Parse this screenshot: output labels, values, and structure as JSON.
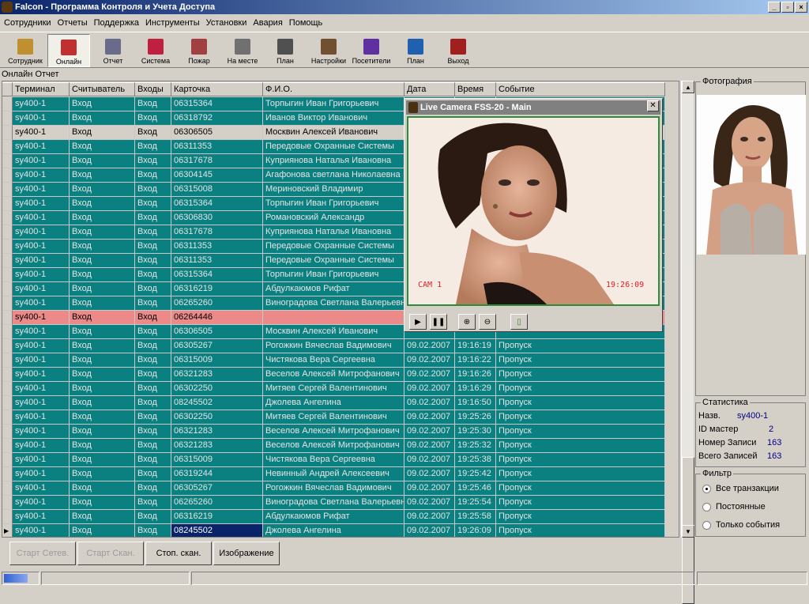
{
  "window": {
    "title": "Falcon - Программа Контроля и Учета Доступа"
  },
  "menu": [
    "Сотрудники",
    "Отчеты",
    "Поддержка",
    "Инструменты",
    "Установки",
    "Авария",
    "Помощь"
  ],
  "toolbar": [
    {
      "label": "Сотрудник",
      "icon": "employee-icon",
      "color": "#c09030"
    },
    {
      "label": "Онлайн",
      "icon": "online-icon",
      "color": "#c03030"
    },
    {
      "label": "Отчет",
      "icon": "report-icon",
      "color": "#6a6a8a"
    },
    {
      "label": "Система",
      "icon": "system-icon",
      "color": "#c02040"
    },
    {
      "label": "Пожар",
      "icon": "fire-icon",
      "color": "#a04040"
    },
    {
      "label": "На месте",
      "icon": "onsite-icon",
      "color": "#707070"
    },
    {
      "label": "План",
      "icon": "plan-icon",
      "color": "#505050"
    },
    {
      "label": "Настройки",
      "icon": "settings-icon",
      "color": "#705030"
    },
    {
      "label": "Посетители",
      "icon": "visitors-icon",
      "color": "#6030a0"
    },
    {
      "label": "План",
      "icon": "globe-icon",
      "color": "#2060b0"
    },
    {
      "label": "Выход",
      "icon": "exit-icon",
      "color": "#a02020"
    }
  ],
  "online_report_label": "Онлайн Отчет",
  "columns": [
    "Терминал",
    "Считыватель",
    "Входы",
    "Карточка",
    "Ф.И.О.",
    "Дата",
    "Время",
    "Событие"
  ],
  "rows": [
    {
      "style": "teal",
      "term": "sy400-1",
      "reader": "Вход",
      "input": "Вход",
      "card": "06315364",
      "name": "Торпыгин Иван Григорьевич",
      "date": "",
      "time": "",
      "event": ""
    },
    {
      "style": "teal",
      "term": "sy400-1",
      "reader": "Вход",
      "input": "Вход",
      "card": "06318792",
      "name": "Иванов Виктор Иванович",
      "date": "",
      "time": "",
      "event": ""
    },
    {
      "style": "gray",
      "term": "sy400-1",
      "reader": "Вход",
      "input": "Вход",
      "card": "06306505",
      "name": "Москвин Алексей Иванович",
      "date": "",
      "time": "",
      "event": ""
    },
    {
      "style": "teal",
      "term": "sy400-1",
      "reader": "Вход",
      "input": "Вход",
      "card": "06311353",
      "name": "Передовые Охранные Системы",
      "date": "",
      "time": "",
      "event": ""
    },
    {
      "style": "teal",
      "term": "sy400-1",
      "reader": "Вход",
      "input": "Вход",
      "card": "06317678",
      "name": "Куприянова Наталья Ивановна",
      "date": "",
      "time": "",
      "event": ""
    },
    {
      "style": "teal",
      "term": "sy400-1",
      "reader": "Вход",
      "input": "Вход",
      "card": "06304145",
      "name": "Агафонова светлана Николаевна",
      "date": "",
      "time": "",
      "event": ""
    },
    {
      "style": "teal",
      "term": "sy400-1",
      "reader": "Вход",
      "input": "Вход",
      "card": "06315008",
      "name": "Мериновский Владимир",
      "date": "",
      "time": "",
      "event": ""
    },
    {
      "style": "teal",
      "term": "sy400-1",
      "reader": "Вход",
      "input": "Вход",
      "card": "06315364",
      "name": "Торпыгин Иван Григорьевич",
      "date": "",
      "time": "",
      "event": ""
    },
    {
      "style": "teal",
      "term": "sy400-1",
      "reader": "Вход",
      "input": "Вход",
      "card": "06306830",
      "name": "Романовский Александр",
      "date": "",
      "time": "",
      "event": ""
    },
    {
      "style": "teal",
      "term": "sy400-1",
      "reader": "Вход",
      "input": "Вход",
      "card": "06317678",
      "name": "Куприянова Наталья Ивановна",
      "date": "",
      "time": "",
      "event": ""
    },
    {
      "style": "teal",
      "term": "sy400-1",
      "reader": "Вход",
      "input": "Вход",
      "card": "06311353",
      "name": "Передовые Охранные Системы",
      "date": "",
      "time": "",
      "event": ""
    },
    {
      "style": "teal",
      "term": "sy400-1",
      "reader": "Вход",
      "input": "Вход",
      "card": "06311353",
      "name": "Передовые Охранные Системы",
      "date": "",
      "time": "",
      "event": ""
    },
    {
      "style": "teal",
      "term": "sy400-1",
      "reader": "Вход",
      "input": "Вход",
      "card": "06315364",
      "name": "Торпыгин Иван Григорьевич",
      "date": "",
      "time": "",
      "event": ""
    },
    {
      "style": "teal",
      "term": "sy400-1",
      "reader": "Вход",
      "input": "Вход",
      "card": "06316219",
      "name": "Абдулкаюмов Рифат",
      "date": "",
      "time": "",
      "event": ""
    },
    {
      "style": "teal",
      "term": "sy400-1",
      "reader": "Вход",
      "input": "Вход",
      "card": "06265260",
      "name": "Виноградова Светлана Валерьевна",
      "date": "",
      "time": "",
      "event": ""
    },
    {
      "style": "pink",
      "term": "sy400-1",
      "reader": "Вход",
      "input": "Вход",
      "card": "06264446",
      "name": "",
      "date": "",
      "time": "",
      "event": ""
    },
    {
      "style": "teal",
      "term": "sy400-1",
      "reader": "Вход",
      "input": "Вход",
      "card": "06306505",
      "name": "Москвин Алексей Иванович",
      "date": "",
      "time": "",
      "event": ""
    },
    {
      "style": "teal",
      "term": "sy400-1",
      "reader": "Вход",
      "input": "Вход",
      "card": "06305267",
      "name": "Рогожкин Вячеслав Вадимович",
      "date": "09.02.2007",
      "time": "19:16:19",
      "event": "Пропуск"
    },
    {
      "style": "teal",
      "term": "sy400-1",
      "reader": "Вход",
      "input": "Вход",
      "card": "06315009",
      "name": "Чистякова Вера Сергеевна",
      "date": "09.02.2007",
      "time": "19:16:22",
      "event": "Пропуск"
    },
    {
      "style": "teal",
      "term": "sy400-1",
      "reader": "Вход",
      "input": "Вход",
      "card": "06321283",
      "name": "Веселов Алексей Митрофанович",
      "date": "09.02.2007",
      "time": "19:16:26",
      "event": "Пропуск"
    },
    {
      "style": "teal",
      "term": "sy400-1",
      "reader": "Вход",
      "input": "Вход",
      "card": "06302250",
      "name": "Митяев Сергей Валентинович",
      "date": "09.02.2007",
      "time": "19:16:29",
      "event": "Пропуск"
    },
    {
      "style": "teal",
      "term": "sy400-1",
      "reader": "Вход",
      "input": "Вход",
      "card": "08245502",
      "name": "Джолева Ангелина",
      "date": "09.02.2007",
      "time": "19:16:50",
      "event": "Пропуск"
    },
    {
      "style": "teal",
      "term": "sy400-1",
      "reader": "Вход",
      "input": "Вход",
      "card": "06302250",
      "name": "Митяев Сергей Валентинович",
      "date": "09.02.2007",
      "time": "19:25:26",
      "event": "Пропуск"
    },
    {
      "style": "teal",
      "term": "sy400-1",
      "reader": "Вход",
      "input": "Вход",
      "card": "06321283",
      "name": "Веселов Алексей Митрофанович",
      "date": "09.02.2007",
      "time": "19:25:30",
      "event": "Пропуск"
    },
    {
      "style": "teal",
      "term": "sy400-1",
      "reader": "Вход",
      "input": "Вход",
      "card": "06321283",
      "name": "Веселов Алексей Митрофанович",
      "date": "09.02.2007",
      "time": "19:25:32",
      "event": "Пропуск"
    },
    {
      "style": "teal",
      "term": "sy400-1",
      "reader": "Вход",
      "input": "Вход",
      "card": "06315009",
      "name": "Чистякова Вера Сергеевна",
      "date": "09.02.2007",
      "time": "19:25:38",
      "event": "Пропуск"
    },
    {
      "style": "teal",
      "term": "sy400-1",
      "reader": "Вход",
      "input": "Вход",
      "card": "06319244",
      "name": "Невинный Андрей Алексеевич",
      "date": "09.02.2007",
      "time": "19:25:42",
      "event": "Пропуск"
    },
    {
      "style": "teal",
      "term": "sy400-1",
      "reader": "Вход",
      "input": "Вход",
      "card": "06305267",
      "name": "Рогожкин Вячеслав Вадимович",
      "date": "09.02.2007",
      "time": "19:25:46",
      "event": "Пропуск"
    },
    {
      "style": "teal",
      "term": "sy400-1",
      "reader": "Вход",
      "input": "Вход",
      "card": "06265260",
      "name": "Виноградова Светлана Валерьевна",
      "date": "09.02.2007",
      "time": "19:25:54",
      "event": "Пропуск"
    },
    {
      "style": "teal",
      "term": "sy400-1",
      "reader": "Вход",
      "input": "Вход",
      "card": "06316219",
      "name": "Абдулкаюмов Рифат",
      "date": "09.02.2007",
      "time": "19:25:58",
      "event": "Пропуск"
    },
    {
      "style": "teal",
      "term": "sy400-1",
      "reader": "Вход",
      "input": "Вход",
      "card": "08245502",
      "name": "Джолева Ангелина",
      "date": "09.02.2007",
      "time": "19:26:09",
      "event": "Пропуск",
      "current": true
    }
  ],
  "camera": {
    "title": "Live Camera FSS-20 - Main",
    "cam_label": "CAM 1",
    "timestamp": "19:26:09",
    "overlay_color": "#e02020"
  },
  "photo_panel": {
    "title": "Фотография"
  },
  "stats": {
    "title": "Статистика",
    "items": [
      {
        "label": "Назв.",
        "value": "sy400-1"
      },
      {
        "label": "ID мастер",
        "value": "2"
      },
      {
        "label": "Номер Записи",
        "value": "163"
      },
      {
        "label": "Всего Записей",
        "value": "163"
      }
    ]
  },
  "filter": {
    "title": "Фильтр",
    "options": [
      {
        "label": "Все транзакции",
        "selected": true
      },
      {
        "label": "Постоянные",
        "selected": false
      },
      {
        "label": "Только события",
        "selected": false
      }
    ]
  },
  "buttons": [
    {
      "label": "Старт Сетев.",
      "enabled": false
    },
    {
      "label": "Старт Скан.",
      "enabled": false
    },
    {
      "label": "Стоп. скан.",
      "enabled": true
    },
    {
      "label": "Изображение",
      "enabled": true
    }
  ]
}
